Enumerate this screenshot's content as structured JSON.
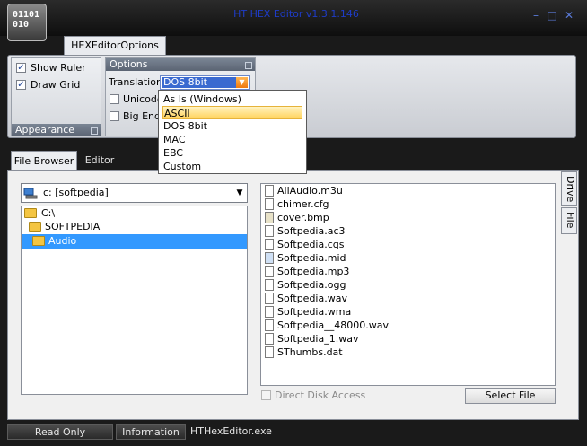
{
  "window": {
    "title": "HT HEX Editor v1.3.1.146",
    "logo_line1": "01101",
    "logo_line2": "010",
    "minimize_glyph": "–",
    "maximize_glyph": "□",
    "close_glyph": "✕"
  },
  "ribbon": {
    "tab": "HEXEditorOptions",
    "appearance": {
      "caption": "Appearance",
      "show_ruler": {
        "label": "Show Ruler",
        "checked": true
      },
      "draw_grid": {
        "label": "Draw Grid",
        "checked": true
      }
    },
    "options": {
      "caption": "Options",
      "translation_label": "Translation",
      "translation_value": "DOS 8bit",
      "unicode_label": "Unicode",
      "big_endian_label": "Big Endi"
    },
    "translation_dropdown": {
      "items": [
        "As Is (Windows)",
        "ASCII",
        "DOS 8bit",
        "MAC",
        "EBC",
        "Custom"
      ],
      "selected": "ASCII"
    }
  },
  "tabs": [
    "File Browser",
    "Editor"
  ],
  "browser": {
    "drive": "c: [softpedia]",
    "tree": [
      "C:\\",
      "SOFTPEDIA",
      "Audio"
    ],
    "tree_selected": "Audio",
    "files": [
      "AllAudio.m3u",
      "chimer.cfg",
      "cover.bmp",
      "Softpedia.ac3",
      "Softpedia.cqs",
      "Softpedia.mid",
      "Softpedia.mp3",
      "Softpedia.ogg",
      "Softpedia.wav",
      "Softpedia.wma",
      "Softpedia__48000.wav",
      "Softpedia_1.wav",
      "SThumbs.dat"
    ],
    "side_tabs": [
      "Drive",
      "File"
    ],
    "direct_disk_access": "Direct Disk Access",
    "select_file": "Select File"
  },
  "status": {
    "read_only": "Read Only",
    "information": "Information",
    "text": "HTHexEditor.exe"
  }
}
